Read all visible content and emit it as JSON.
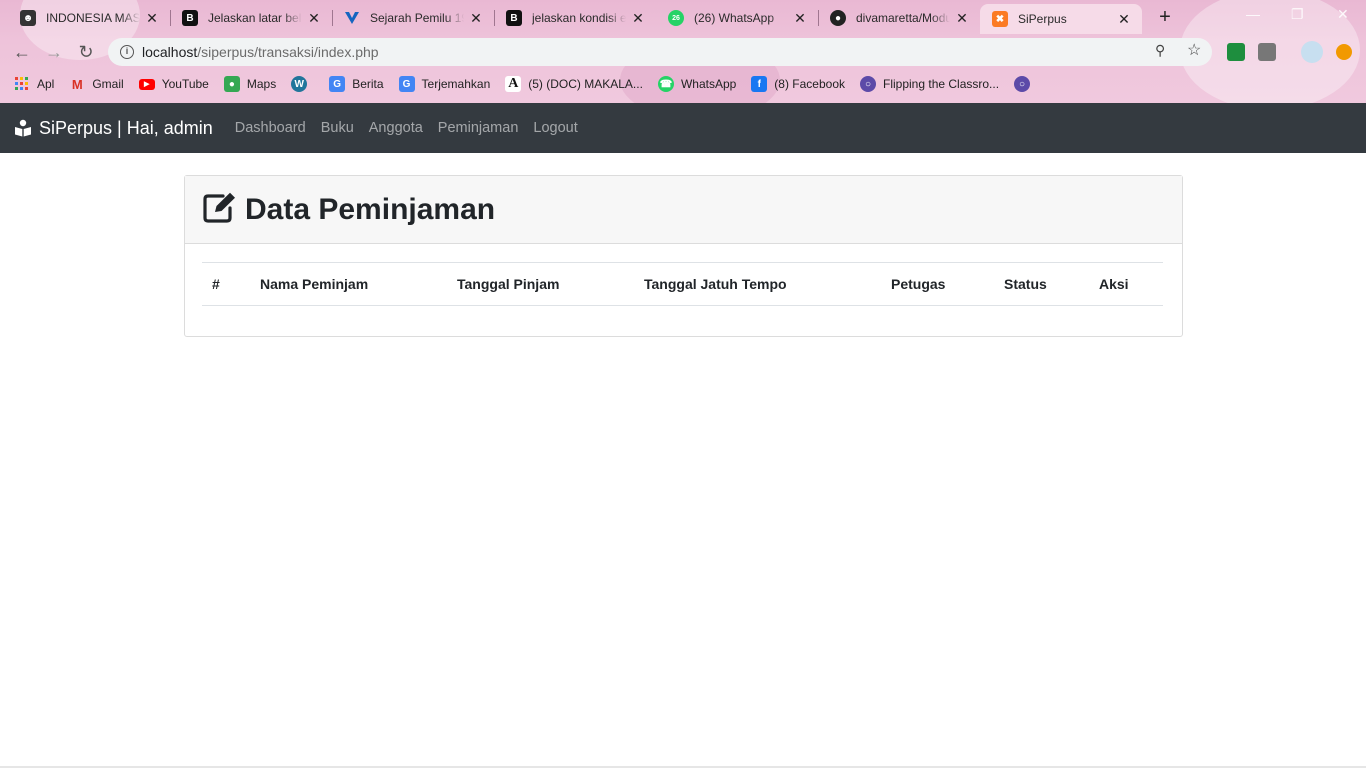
{
  "browser": {
    "tabs": [
      {
        "title": "INDONESIA MASA",
        "favicon": "contacts-icon",
        "active": false
      },
      {
        "title": "Jelaskan latar bela",
        "favicon": "brainly-icon",
        "active": false
      },
      {
        "title": "Sejarah Pemilu 19",
        "favicon": "blue-v-icon",
        "active": false
      },
      {
        "title": "jelaskan kondisi ek",
        "favicon": "brainly-icon",
        "active": false
      },
      {
        "title": "(26) WhatsApp",
        "favicon": "whatsapp-icon",
        "active": false
      },
      {
        "title": "divamaretta/Modu",
        "favicon": "github-icon",
        "active": false
      },
      {
        "title": "SiPerpus",
        "favicon": "xampp-icon",
        "active": true
      }
    ],
    "address": {
      "host": "localhost",
      "path": "/siperpus/transaksi/index.php"
    },
    "bookmarks": [
      {
        "label": "Apl",
        "icon": "apps-grid-icon"
      },
      {
        "label": "Gmail",
        "icon": "gmail-icon"
      },
      {
        "label": "YouTube",
        "icon": "youtube-icon"
      },
      {
        "label": "Maps",
        "icon": "maps-icon"
      },
      {
        "label": "",
        "icon": "wordpress-icon"
      },
      {
        "label": "Berita",
        "icon": "news-icon"
      },
      {
        "label": "Terjemahkan",
        "icon": "translate-icon"
      },
      {
        "label": "(5) (DOC) MAKALA...",
        "icon": "academia-icon"
      },
      {
        "label": "WhatsApp",
        "icon": "whatsapp-icon"
      },
      {
        "label": "(8) Facebook",
        "icon": "facebook-icon"
      },
      {
        "label": "Flipping the Classro...",
        "icon": "globe-icon"
      },
      {
        "label": "",
        "icon": "globe-icon"
      }
    ]
  },
  "navbar": {
    "brand": "SiPerpus | Hai, admin",
    "links": [
      "Dashboard",
      "Buku",
      "Anggota",
      "Peminjaman",
      "Logout"
    ]
  },
  "page": {
    "title": "Data Peminjaman",
    "title_icon": "edit-icon",
    "table": {
      "columns": [
        "#",
        "Nama Peminjam",
        "Tanggal Pinjam",
        "Tanggal Jatuh Tempo",
        "Petugas",
        "Status",
        "Aksi"
      ],
      "rows": []
    }
  }
}
